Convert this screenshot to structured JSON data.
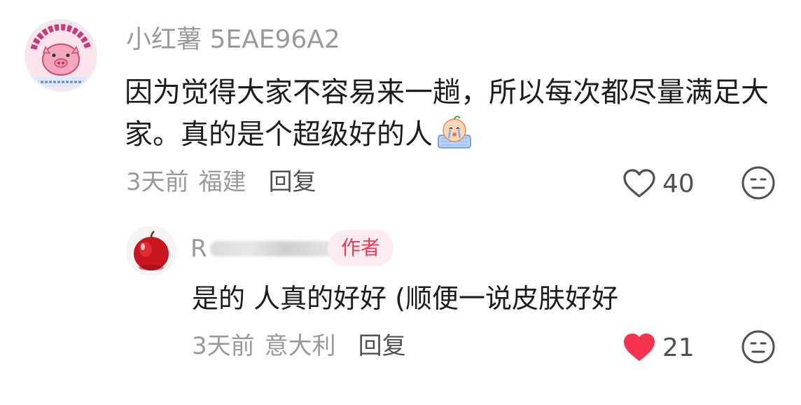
{
  "comment": {
    "avatar_icon": "pink-pig-sticker-avatar",
    "author": "小红薯 5EAE96A2",
    "text": "因为觉得大家不容易来一趟，所以每次都尽量满足大家。真的是个超级好的人",
    "emoji": "crying-face-emoji",
    "time": "3天前",
    "location": "福建",
    "reply_label": "回复",
    "likes": "40",
    "liked": false
  },
  "reply": {
    "avatar_icon": "red-apple-avatar",
    "author_visible": "R",
    "badge": "作者",
    "text": "是的 人真的好好 (顺便一说皮肤好好",
    "time": "3天前",
    "location": "意大利",
    "reply_label": "回复",
    "likes": "21",
    "liked": true
  },
  "colors": {
    "liked_heart": "#f5334f",
    "badge_text": "#f03a58",
    "badge_bg": "#fdecef"
  }
}
